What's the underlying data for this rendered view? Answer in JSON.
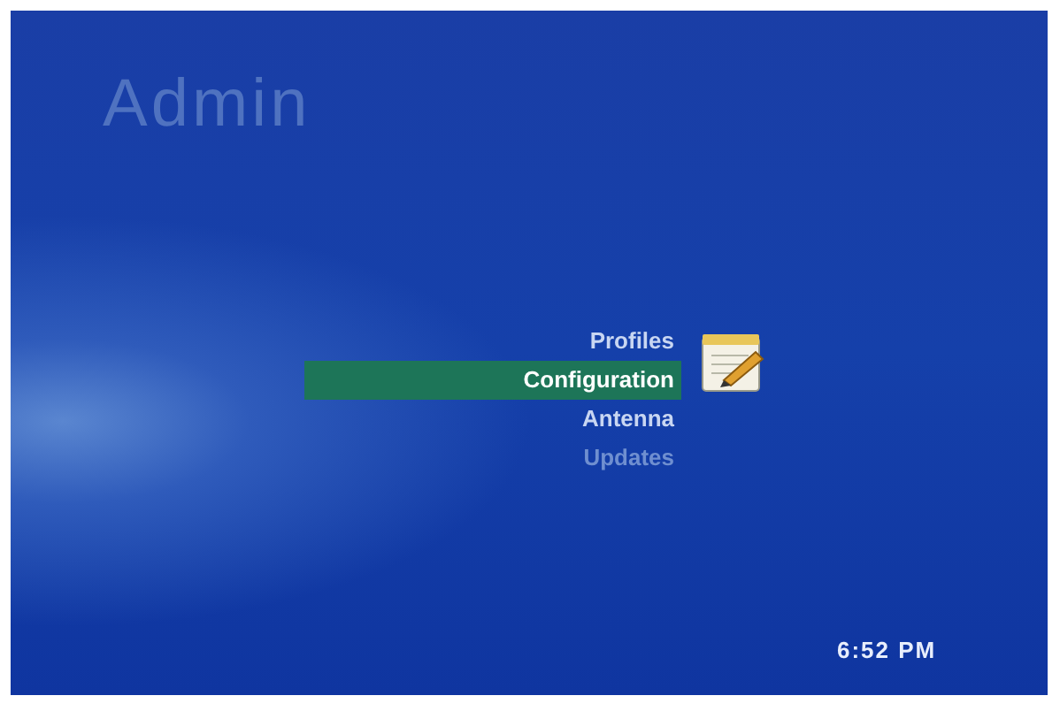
{
  "screen": {
    "title": "Admin"
  },
  "menu": [
    {
      "label": "Profiles",
      "selected": false,
      "disabled": false
    },
    {
      "label": "Configuration",
      "selected": true,
      "disabled": false
    },
    {
      "label": "Antenna",
      "selected": false,
      "disabled": false
    },
    {
      "label": "Updates",
      "selected": false,
      "disabled": true
    }
  ],
  "clock": "6:52 PM"
}
